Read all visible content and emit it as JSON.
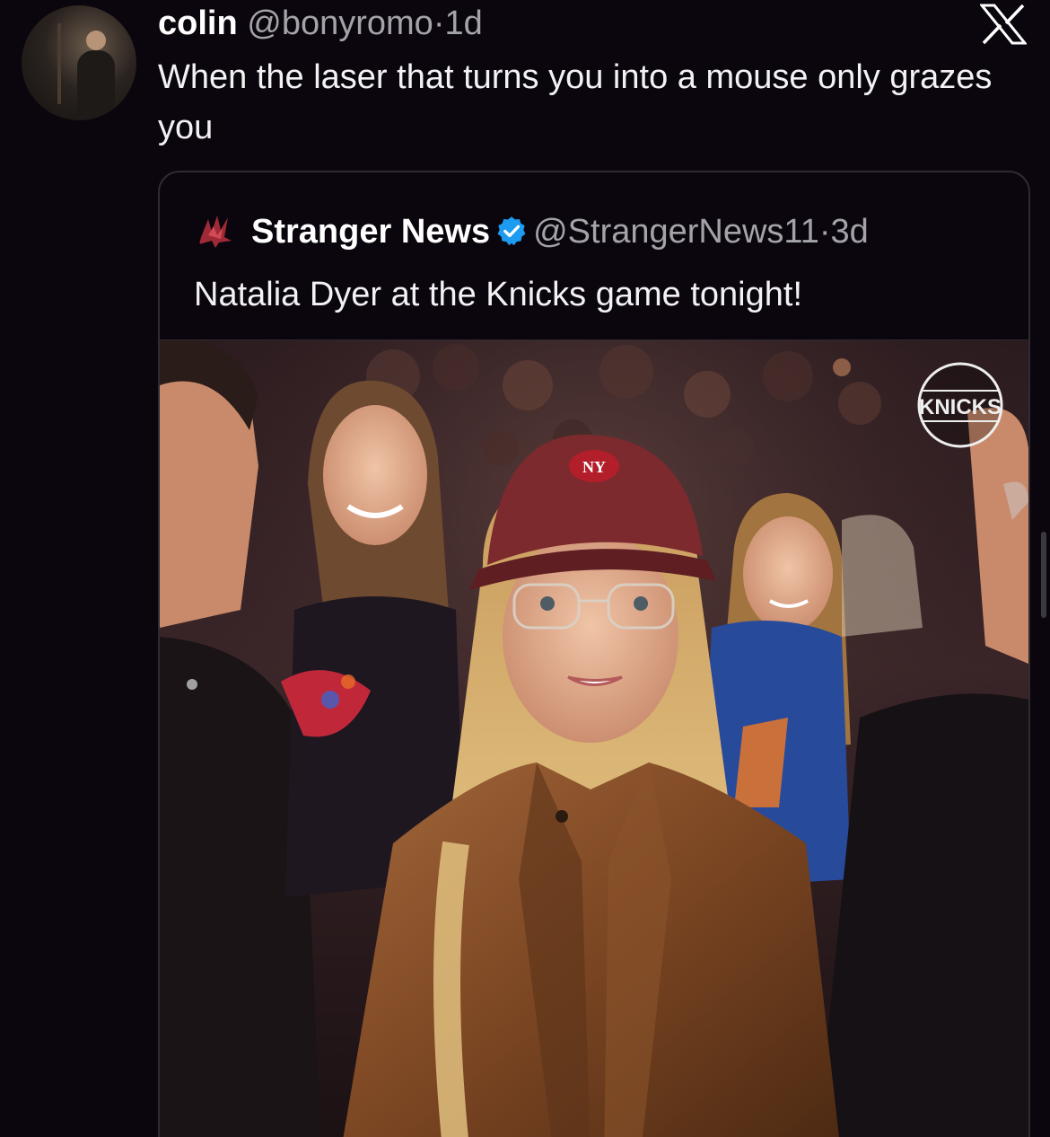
{
  "tweet": {
    "display_name": "colin",
    "handle": "@bonyromo",
    "separator": "·",
    "time": "1d",
    "text": "When the laser that turns you into a mouse only grazes you"
  },
  "brand": {
    "logo_icon": "x-logo-icon"
  },
  "quote": {
    "display_name": "Stranger News",
    "verified_icon": "verified-badge-icon",
    "handle": "@StrangerNews11",
    "separator": "·",
    "time": "3d",
    "text": "Natalia Dyer at the Knicks game tonight!",
    "media": {
      "logo_text": "KNICKS",
      "cap_logo_text": "NY"
    }
  },
  "colors": {
    "background": "#0b050d",
    "text": "#ffffff",
    "secondary_text": "#a3a3a8",
    "verified": "#1d9bf0",
    "card_border": "#2e2b33"
  }
}
